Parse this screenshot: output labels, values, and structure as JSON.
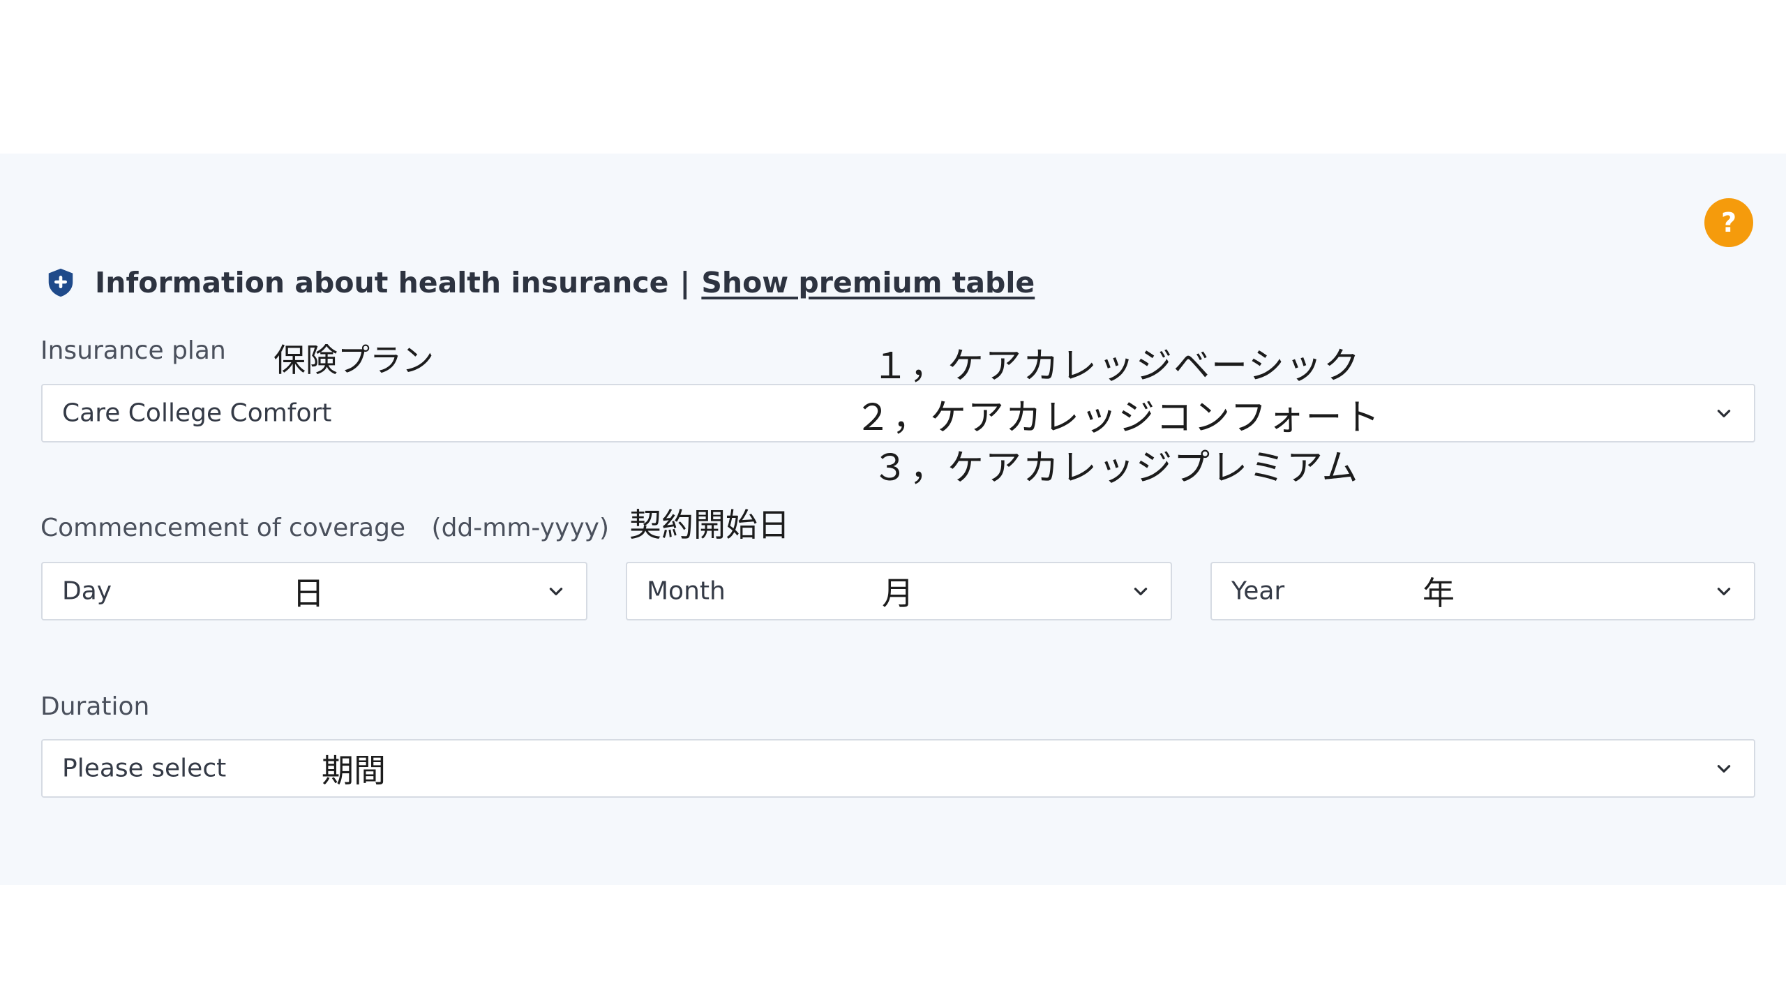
{
  "header": {
    "title": "Information about health insurance",
    "separator": "|",
    "link": "Show premium table"
  },
  "help_button": {
    "label": "?"
  },
  "insurance_plan": {
    "label": "Insurance plan",
    "jp_label": "保険プラン",
    "value": "Care College Comfort",
    "options_jp": [
      "１，ケアカレッジベーシック",
      "２，ケアカレッジコンフォート",
      "３，ケアカレッジプレミアム"
    ]
  },
  "coverage": {
    "label": "Commencement of coverage",
    "format_hint": "(dd-mm-yyyy)",
    "jp_label": "契約開始日",
    "day": {
      "placeholder": "Day",
      "jp": "日"
    },
    "month": {
      "placeholder": "Month",
      "jp": "月"
    },
    "year": {
      "placeholder": "Year",
      "jp": "年"
    }
  },
  "duration": {
    "label": "Duration",
    "placeholder": "Please select",
    "jp": "期間"
  },
  "colors": {
    "panel_bg": "#f5f8fc",
    "help_accent": "#f59b0c",
    "shield": "#1f4a8a",
    "border": "#d6dbe3"
  },
  "icons": {
    "shield": "shield-plus-icon",
    "chevron": "chevron-down-icon",
    "help": "question-icon"
  }
}
